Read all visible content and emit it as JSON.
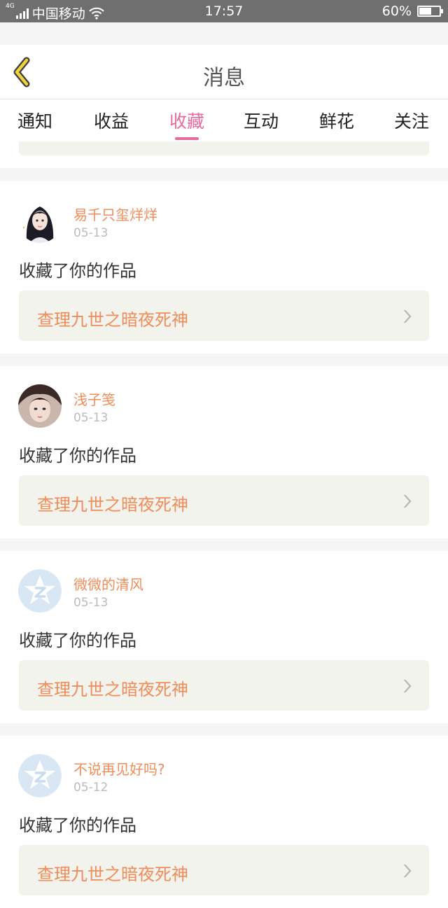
{
  "status_bar": {
    "network_tag": "4G",
    "carrier": "中国移动",
    "time": "17:57",
    "battery": "60%",
    "battery_level": 0.6
  },
  "header": {
    "title": "消息"
  },
  "tabs": [
    {
      "label": "通知",
      "active": false
    },
    {
      "label": "收益",
      "active": false
    },
    {
      "label": "收藏",
      "active": true
    },
    {
      "label": "互动",
      "active": false
    },
    {
      "label": "鲜花",
      "active": false
    },
    {
      "label": "关注",
      "active": false
    }
  ],
  "colors": {
    "accent": "#e66a9e",
    "name": "#ee8d5a",
    "card_inner": "#f3f3ee"
  },
  "messages": [
    {
      "user": "易千只玺烊烊",
      "date": "05-13",
      "action": "收藏了你的作品",
      "work": "查理九世之暗夜死神",
      "avatar": "anime-girl-avatar"
    },
    {
      "user": "浅子笺",
      "date": "05-13",
      "action": "收藏了你的作品",
      "work": "查理九世之暗夜死神",
      "avatar": "photo-girl-avatar"
    },
    {
      "user": "微微的清风",
      "date": "05-13",
      "action": "收藏了你的作品",
      "work": "查理九世之暗夜死神",
      "avatar": "default-qzone-avatar"
    },
    {
      "user": "不说再见好吗?",
      "date": "05-12",
      "action": "收藏了你的作品",
      "work": "查理九世之暗夜死神",
      "avatar": "default-qzone-avatar"
    }
  ]
}
